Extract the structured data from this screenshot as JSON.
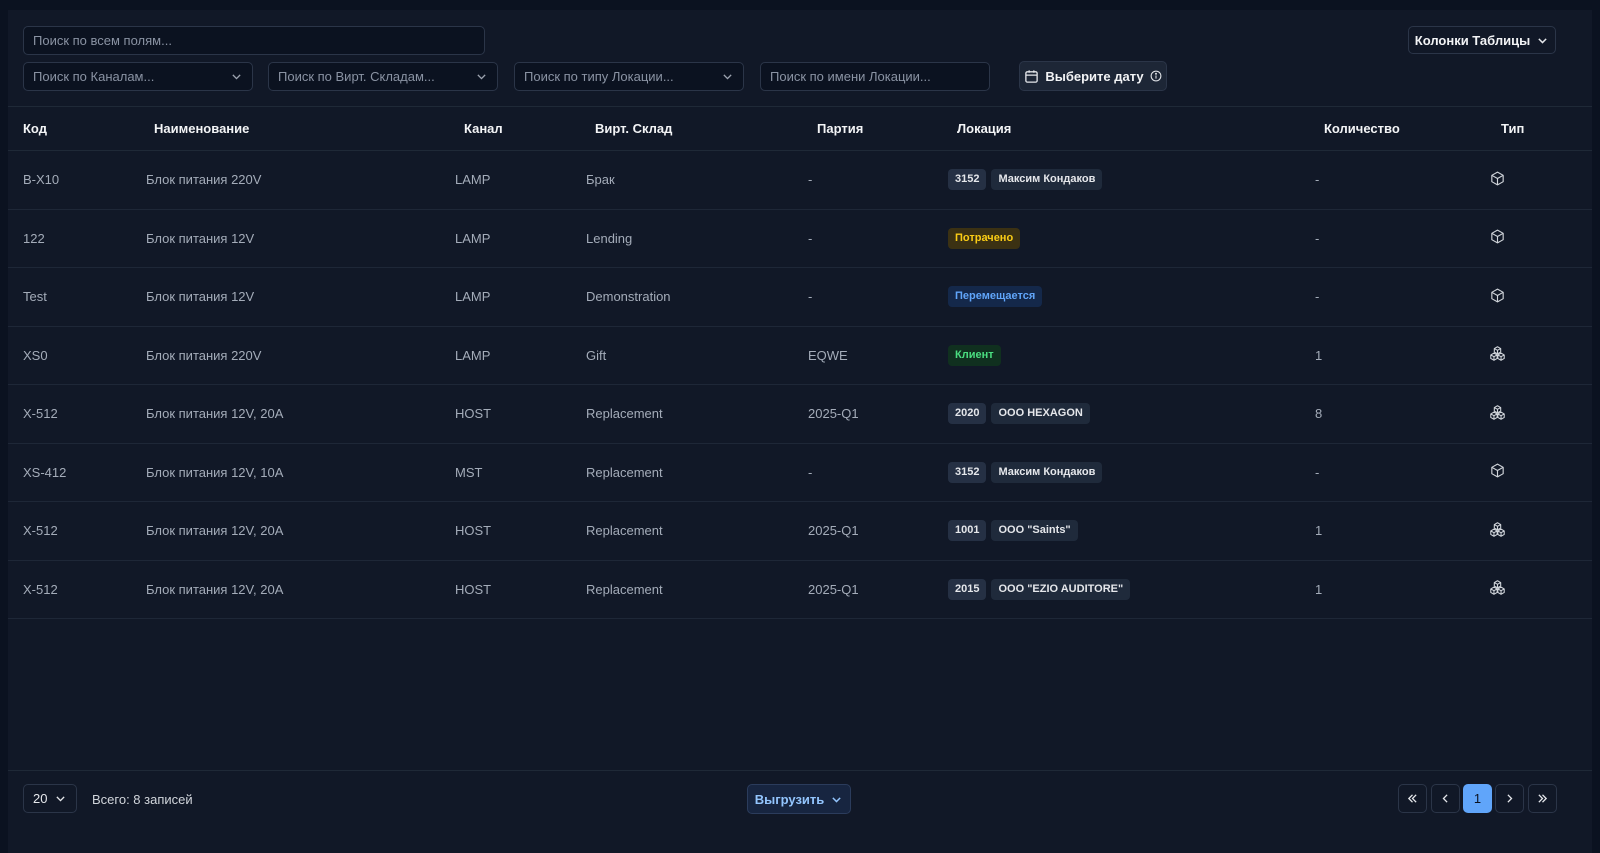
{
  "filters": {
    "global_search_placeholder": "Поиск по всем полям...",
    "channels_placeholder": "Поиск по Каналам...",
    "warehouses_placeholder": "Поиск по Вирт. Складам...",
    "location_type_placeholder": "Поиск по типу Локации...",
    "location_name_placeholder": "Поиск по имени Локации...",
    "date_button_label": "Выберите дату",
    "columns_button_label": "Колонки Таблицы"
  },
  "table": {
    "columns": [
      "Код",
      "Наименование",
      "Канал",
      "Вирт. Склад",
      "Партия",
      "Локация",
      "Количество",
      "Тип"
    ],
    "rows": [
      {
        "code": "B-X10",
        "name": "Блок питания 220V",
        "channel": "LAMP",
        "warehouse": "Брак",
        "batch": "-",
        "location": [
          {
            "text": "3152",
            "style": "code"
          },
          {
            "text": "Максим Кондаков",
            "style": "plain"
          }
        ],
        "qty": "-",
        "type_icon": "box-icon"
      },
      {
        "code": "122",
        "name": "Блок питания 12V",
        "channel": "LAMP",
        "warehouse": "Lending",
        "batch": "-",
        "location": [
          {
            "text": "Потрачено",
            "style": "yellow"
          }
        ],
        "qty": "-",
        "type_icon": "box-icon"
      },
      {
        "code": "Test",
        "name": "Блок питания 12V",
        "channel": "LAMP",
        "warehouse": "Demonstration",
        "batch": "-",
        "location": [
          {
            "text": "Перемещается",
            "style": "blue"
          }
        ],
        "qty": "-",
        "type_icon": "box-icon"
      },
      {
        "code": "XS0",
        "name": "Блок питания 220V",
        "channel": "LAMP",
        "warehouse": "Gift",
        "batch": "EQWE",
        "location": [
          {
            "text": "Клиент",
            "style": "green"
          }
        ],
        "qty": "1",
        "type_icon": "boxes-icon"
      },
      {
        "code": "X-512",
        "name": "Блок питания 12V, 20A",
        "channel": "HOST",
        "warehouse": "Replacement",
        "batch": "2025-Q1",
        "location": [
          {
            "text": "2020",
            "style": "code"
          },
          {
            "text": "ООО HEXAGON",
            "style": "plain"
          }
        ],
        "qty": "8",
        "type_icon": "boxes-icon"
      },
      {
        "code": "XS-412",
        "name": "Блок питания 12V, 10A",
        "channel": "MST",
        "warehouse": "Replacement",
        "batch": "-",
        "location": [
          {
            "text": "3152",
            "style": "code"
          },
          {
            "text": "Максим Кондаков",
            "style": "plain"
          }
        ],
        "qty": "-",
        "type_icon": "box-icon"
      },
      {
        "code": "X-512",
        "name": "Блок питания 12V, 20A",
        "channel": "HOST",
        "warehouse": "Replacement",
        "batch": "2025-Q1",
        "location": [
          {
            "text": "1001",
            "style": "code"
          },
          {
            "text": "ООО \"Saints\"",
            "style": "plain"
          }
        ],
        "qty": "1",
        "type_icon": "boxes-icon"
      },
      {
        "code": "X-512",
        "name": "Блок питания 12V, 20A",
        "channel": "HOST",
        "warehouse": "Replacement",
        "batch": "2025-Q1",
        "location": [
          {
            "text": "2015",
            "style": "code"
          },
          {
            "text": "ООО \"EZIO AUDITORE\"",
            "style": "plain"
          }
        ],
        "qty": "1",
        "type_icon": "boxes-icon"
      }
    ]
  },
  "footer": {
    "page_size": "20",
    "total_label": "Всего: 8 записей",
    "export_label": "Выгрузить",
    "current_page": "1"
  },
  "colors": {
    "background": "#0b1220",
    "panel": "#111827",
    "accent": "#60a5fa",
    "badge_yellow": "#facc15",
    "badge_green": "#4ade80"
  }
}
